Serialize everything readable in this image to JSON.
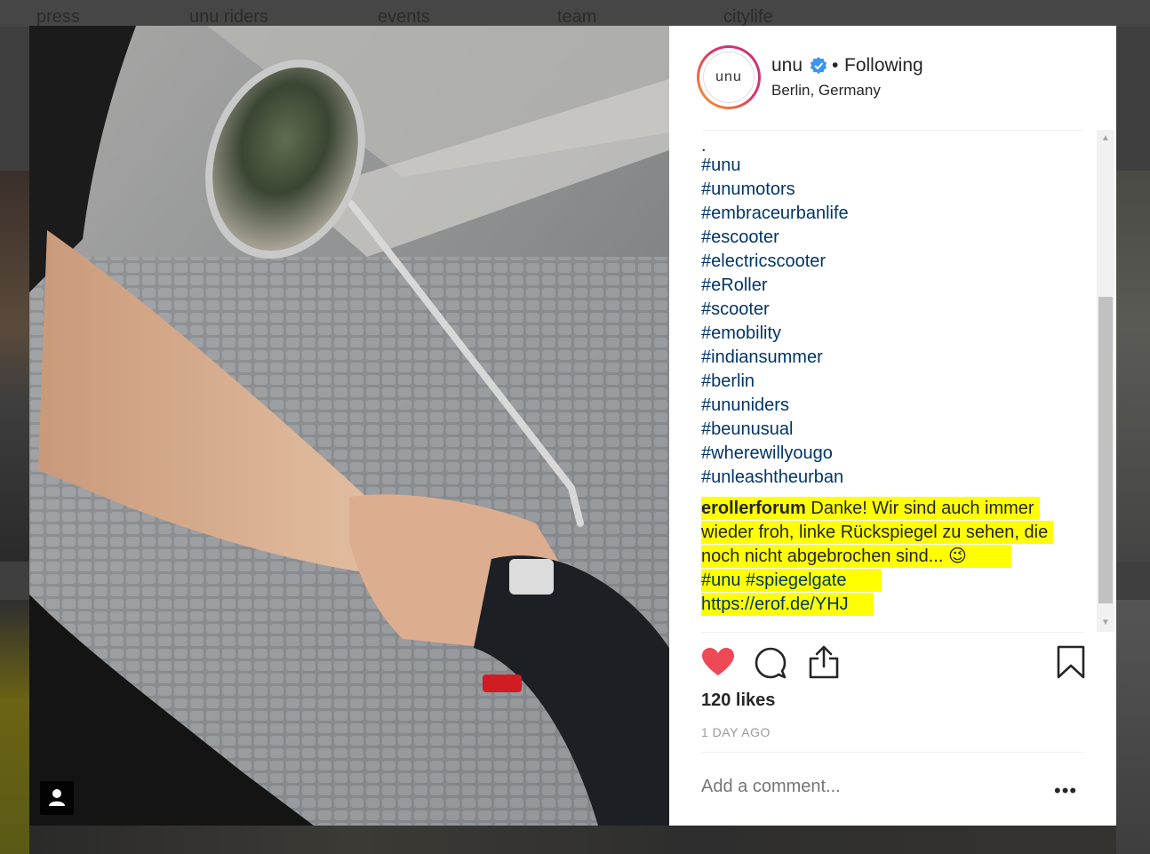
{
  "background_nav": {
    "items": [
      "press",
      "unu riders",
      "events",
      "team",
      "citylife"
    ]
  },
  "post": {
    "username": "unu",
    "avatar_text": "unu",
    "follow_status": "Following",
    "separator": "•",
    "location": "Berlin, Germany",
    "caption_lines": [
      ".",
      "#unu",
      "#unumotors",
      "#embraceurbanlife",
      "#escooter",
      "#electricscooter",
      "#eRoller",
      "#scooter",
      "#emobility",
      "#indiansummer",
      "#berlin",
      "#ununiders",
      "#beunusual",
      "#wherewillyougo",
      "#unleashtheurban"
    ],
    "highlighted_comment": {
      "author": "erollerforum",
      "text_line1": "Danke! Wir sind auch immer",
      "text_line2": "wieder froh, linke Rückspiegel zu sehen, die",
      "text_line3": "noch nicht abgebrochen sind... 😉",
      "text_line4": "#unu #spiegelgate",
      "text_line5": "https://erof.de/YHJ"
    },
    "likes": "120 likes",
    "time_ago": "1 DAY AGO",
    "comment_placeholder": "Add a comment...",
    "more_label": "•••"
  },
  "colors": {
    "like_red": "#ed4956",
    "highlight_yellow": "#ffff00",
    "hashtag_blue": "#003569",
    "verified_blue": "#3897f0"
  },
  "icons": [
    "heart-icon",
    "comment-icon",
    "share-icon",
    "bookmark-icon",
    "verified-icon",
    "user-tag-icon"
  ]
}
